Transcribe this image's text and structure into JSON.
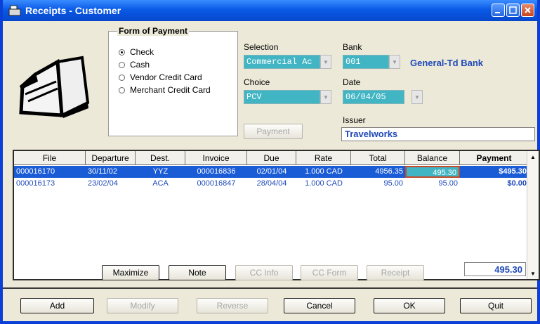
{
  "window": {
    "title": "Receipts - Customer"
  },
  "form_of_payment": {
    "legend": "Form of Payment",
    "options": [
      {
        "label": "Check",
        "selected": true
      },
      {
        "label": "Cash",
        "selected": false
      },
      {
        "label": "Vendor Credit Card",
        "selected": false
      },
      {
        "label": "Merchant Credit Card",
        "selected": false
      }
    ]
  },
  "fields": {
    "selection_label": "Selection",
    "selection_value": "Commercial Ac",
    "bank_label": "Bank",
    "bank_value": "001",
    "bank_name": "General-Td Bank",
    "choice_label": "Choice",
    "choice_value": "PCV",
    "date_label": "Date",
    "date_value": "06/04/05",
    "issuer_label": "Issuer",
    "issuer_value": "Travelworks"
  },
  "buttons": {
    "payment": "Payment",
    "maximize": "Maximize",
    "note": "Note",
    "cc_info": "CC Info",
    "cc_form": "CC Form",
    "receipt": "Receipt",
    "add": "Add",
    "modify": "Modify",
    "reverse": "Reverse",
    "cancel": "Cancel",
    "ok": "OK",
    "quit": "Quit"
  },
  "table": {
    "headers": [
      "File",
      "Departure",
      "Dest.",
      "Invoice",
      "Due",
      "Rate",
      "Total",
      "Balance",
      "Payment"
    ],
    "rows": [
      [
        "000016170",
        "30/11/02",
        "YYZ",
        "000016836",
        "02/01/04",
        "1.000 CAD",
        "4956.35",
        "495.30",
        "$495.30"
      ],
      [
        "000016173",
        "23/02/04",
        "ACA",
        "000016847",
        "28/04/04",
        "1.000 CAD",
        "95.00",
        "95.00",
        "$0.00"
      ]
    ]
  },
  "payment_total": "495.30",
  "colors": {
    "titlebar": "#0a5ae6",
    "combo": "#41b5c3",
    "selected_row": "#1a5bd6",
    "accent_text": "#1f49b8"
  }
}
